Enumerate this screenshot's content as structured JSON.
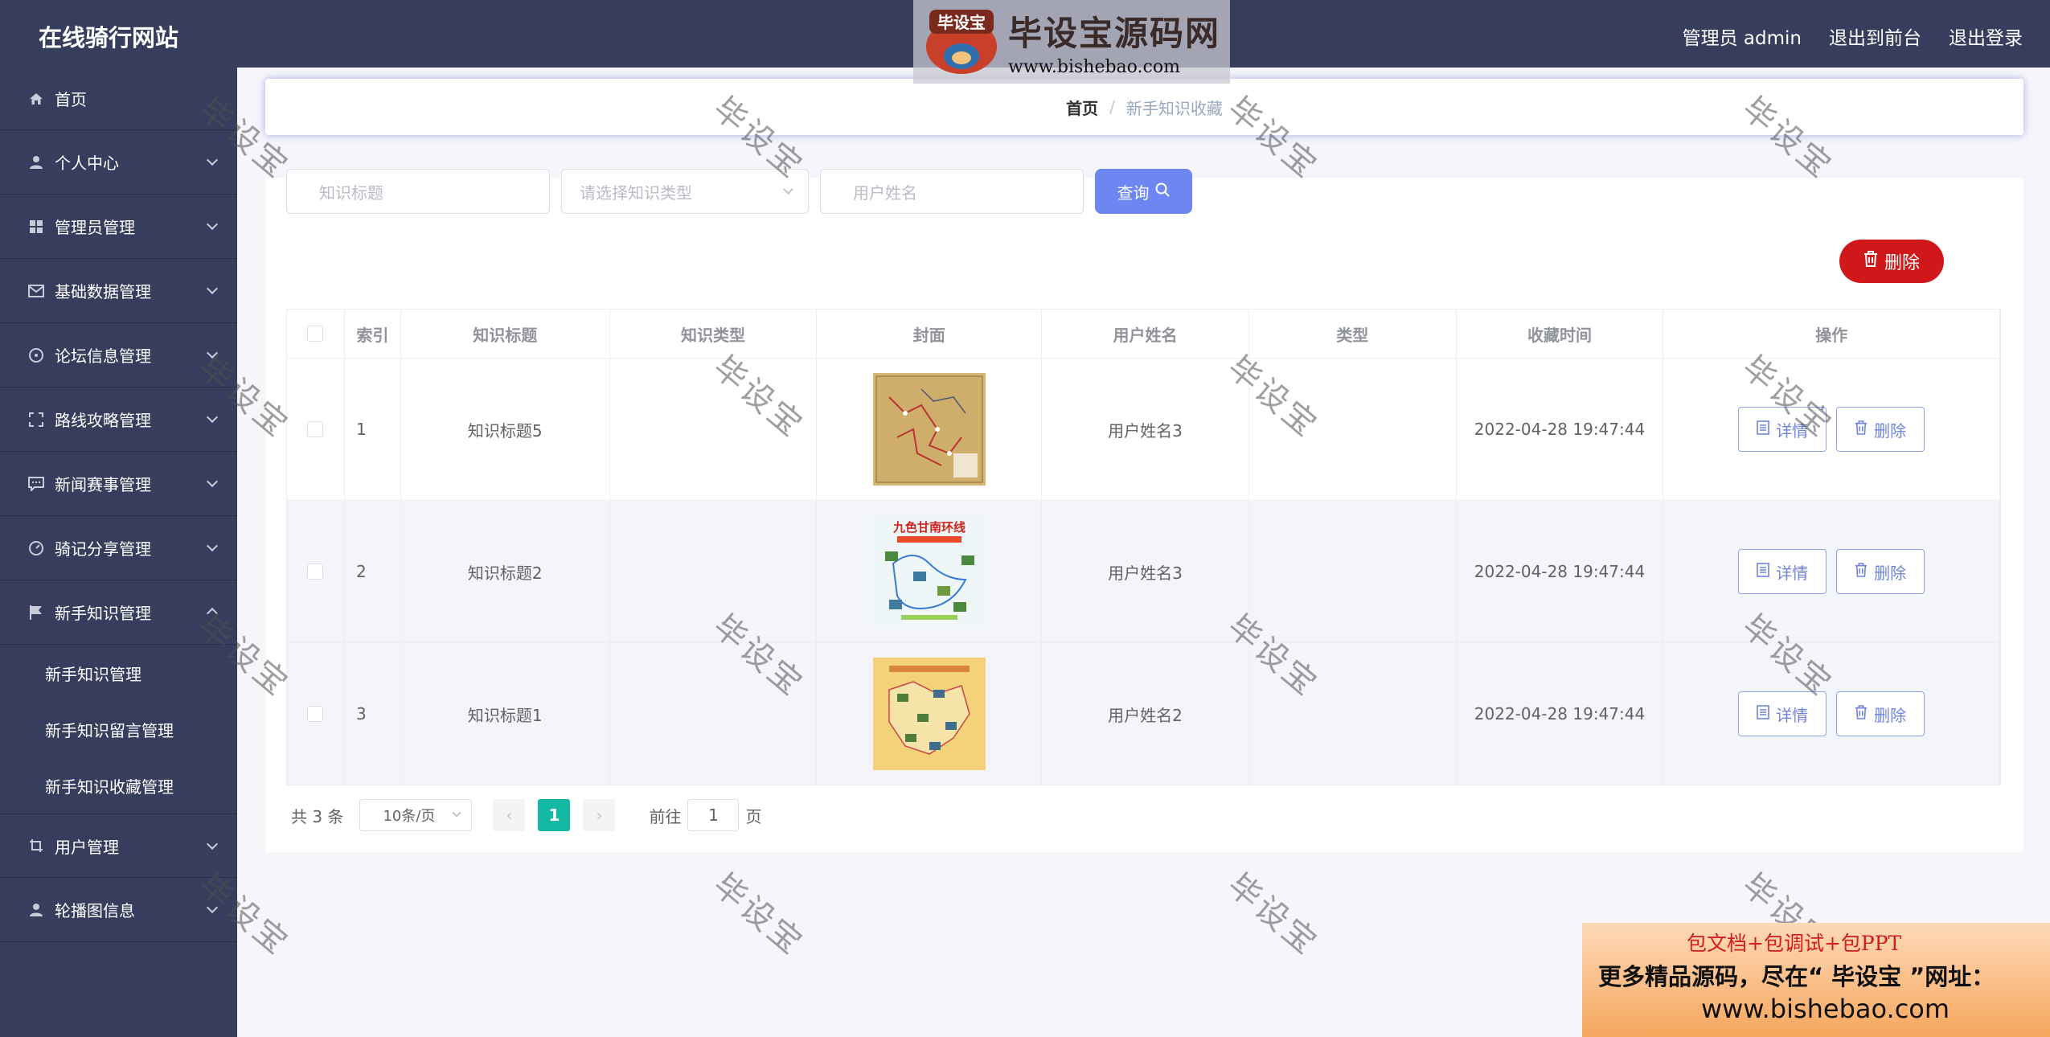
{
  "header": {
    "site_title": "在线骑行网站",
    "admin_label": "管理员 admin",
    "back_to_front": "退出到前台",
    "logout": "退出登录"
  },
  "watermark_logo": {
    "badge": "毕设宝",
    "name": "毕设宝源码网",
    "url": "www.bishebao.com"
  },
  "sidebar": {
    "items": [
      {
        "label": "首页",
        "icon": "home-icon"
      },
      {
        "label": "个人中心",
        "icon": "user-icon"
      },
      {
        "label": "管理员管理",
        "icon": "grid-icon"
      },
      {
        "label": "基础数据管理",
        "icon": "mail-icon"
      },
      {
        "label": "论坛信息管理",
        "icon": "compass-icon"
      },
      {
        "label": "路线攻略管理",
        "icon": "frame-icon"
      },
      {
        "label": "新闻赛事管理",
        "icon": "chat-icon"
      },
      {
        "label": "骑记分享管理",
        "icon": "gauge-icon"
      },
      {
        "label": "新手知识管理",
        "icon": "flag-icon"
      },
      {
        "label": "用户管理",
        "icon": "crop-icon"
      },
      {
        "label": "轮播图信息",
        "icon": "user-icon"
      }
    ],
    "submenu": [
      "新手知识管理",
      "新手知识留言管理",
      "新手知识收藏管理"
    ]
  },
  "breadcrumb": {
    "home": "首页",
    "separator": "/",
    "current": "新手知识收藏"
  },
  "search": {
    "title_placeholder": "知识标题",
    "type_placeholder": "请选择知识类型",
    "user_placeholder": "用户姓名",
    "query_button": "查询"
  },
  "toolbar": {
    "delete_label": "删除"
  },
  "table": {
    "headers": [
      "",
      "索引",
      "知识标题",
      "知识类型",
      "封面",
      "用户姓名",
      "类型",
      "收藏时间",
      "操作"
    ],
    "rows": [
      {
        "index": "1",
        "title": "知识标题5",
        "type": "",
        "user": "用户姓名3",
        "kind": "",
        "time": "2022-04-28 19:47:44"
      },
      {
        "index": "2",
        "title": "知识标题2",
        "type": "",
        "user": "用户姓名3",
        "kind": "",
        "time": "2022-04-28 19:47:44"
      },
      {
        "index": "3",
        "title": "知识标题1",
        "type": "",
        "user": "用户姓名2",
        "kind": "",
        "time": "2022-04-28 19:47:44"
      }
    ],
    "detail_label": "详情",
    "delete_label": "删除"
  },
  "covers": {
    "cover2_title": "九色甘南环线"
  },
  "pagination": {
    "total": "共 3 条",
    "page_size": "10条/页",
    "current_page": "1",
    "goto_label": "前往",
    "goto_value": "1",
    "page_unit": "页"
  },
  "watermark_text": "毕设宝",
  "ad": {
    "line1": "包文档+包调试+包PPT",
    "line2": "更多精品源码，尽在“ 毕设宝 ”网址：",
    "line3": "www.bishebao.com"
  },
  "colors": {
    "sidebar_bg": "#373d5c",
    "primary": "#6d86f1",
    "danger": "#d0181b",
    "pager_active": "#13b9a4"
  }
}
